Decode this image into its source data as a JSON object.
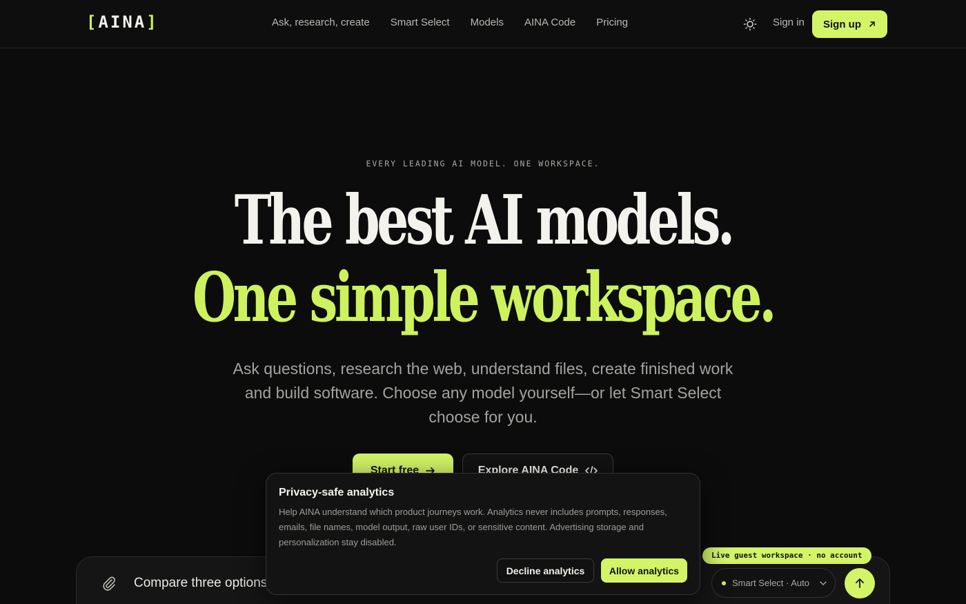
{
  "header": {
    "logo_open": "[",
    "logo_text": "AINA",
    "logo_close": "]",
    "nav": [
      {
        "label": "Ask, research, create"
      },
      {
        "label": "Smart Select"
      },
      {
        "label": "Models"
      },
      {
        "label": "AINA Code"
      },
      {
        "label": "Pricing"
      }
    ],
    "theme_icon": "sun-icon",
    "signin_label": "Sign in",
    "signup_label": "Sign up"
  },
  "hero": {
    "eyebrow": "EVERY LEADING AI MODEL. ONE WORKSPACE.",
    "headline_1": "The best AI models.",
    "headline_2": "One simple workspace.",
    "subtitle": "Ask questions, research the web, understand files, create finished work and build software. Choose any model yourself—or let Smart Select choose for you.",
    "cta_primary": "Start free",
    "cta_secondary": "Explore AINA Code"
  },
  "composer": {
    "prompt": "Compare three options f",
    "guest_badge": "Live guest workspace · no account",
    "model_select": "Smart Select · Auto"
  },
  "consent": {
    "title": "Privacy-safe analytics",
    "body": "Help AINA understand which product journeys work. Analytics never includes prompts, responses, emails, file names, model output, raw user IDs, or sensitive content. Advertising storage and personalization stay disabled.",
    "decline_label": "Decline analytics",
    "allow_label": "Allow analytics"
  },
  "colors": {
    "accent": "#d3f467",
    "background": "#0c0c0c"
  }
}
